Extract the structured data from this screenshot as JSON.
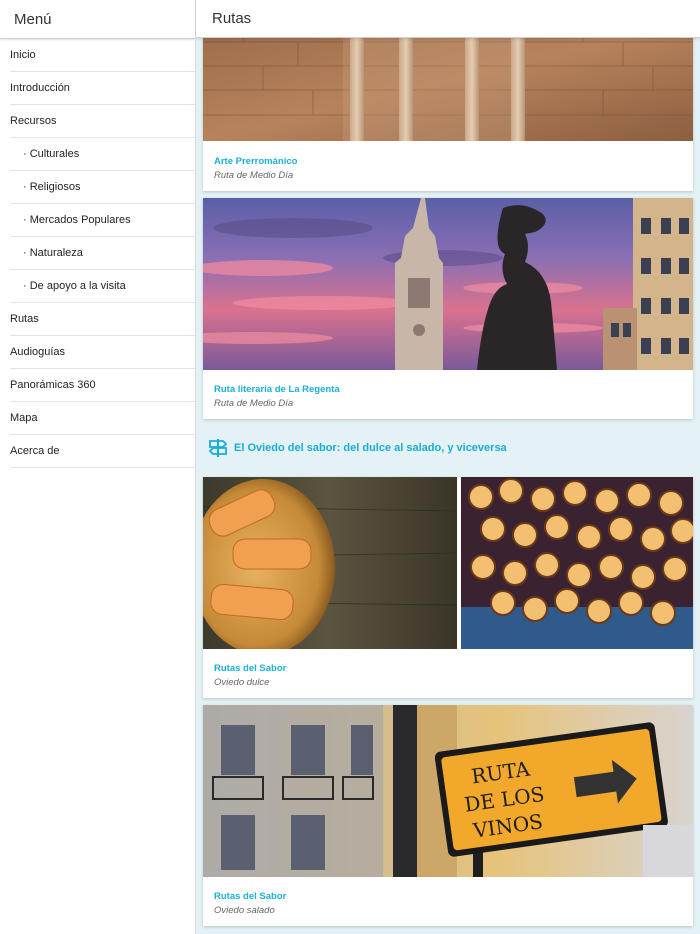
{
  "sidebar": {
    "title": "Menú",
    "items": [
      {
        "label": "Inicio",
        "sub": false
      },
      {
        "label": "Introducción",
        "sub": false
      },
      {
        "label": "Recursos",
        "sub": false
      },
      {
        "label": "· Culturales",
        "sub": true
      },
      {
        "label": "· Religiosos",
        "sub": true
      },
      {
        "label": "· Mercados Populares",
        "sub": true
      },
      {
        "label": "· Naturaleza",
        "sub": true
      },
      {
        "label": "· De apoyo a la visita",
        "sub": true
      },
      {
        "label": "Rutas",
        "sub": false
      },
      {
        "label": "Audioguías",
        "sub": false
      },
      {
        "label": "Panorámicas 360",
        "sub": false
      },
      {
        "label": "Mapa",
        "sub": false
      },
      {
        "label": "Acerca de",
        "sub": false
      }
    ]
  },
  "main": {
    "title": "Rutas",
    "cards": [
      {
        "title": "Arte Prerrománico",
        "subtitle": "Ruta de Medio Día"
      },
      {
        "title": "Ruta literaria de La Regenta",
        "subtitle": "Ruta de Medio Día"
      },
      {
        "title": "Rutas del Sabor",
        "subtitle": "Oviedo dulce"
      },
      {
        "title": "Rutas del Sabor",
        "subtitle": "Oviedo salado"
      }
    ],
    "section": {
      "icon": "signpost-icon",
      "label": "El Oviedo del sabor: del dulce al salado, y viceversa"
    }
  },
  "sign_text": [
    "RUTA",
    "DE LOS",
    "VINOS"
  ],
  "colors": {
    "accent": "#1ab0d8",
    "background": "#e4f2f6"
  }
}
